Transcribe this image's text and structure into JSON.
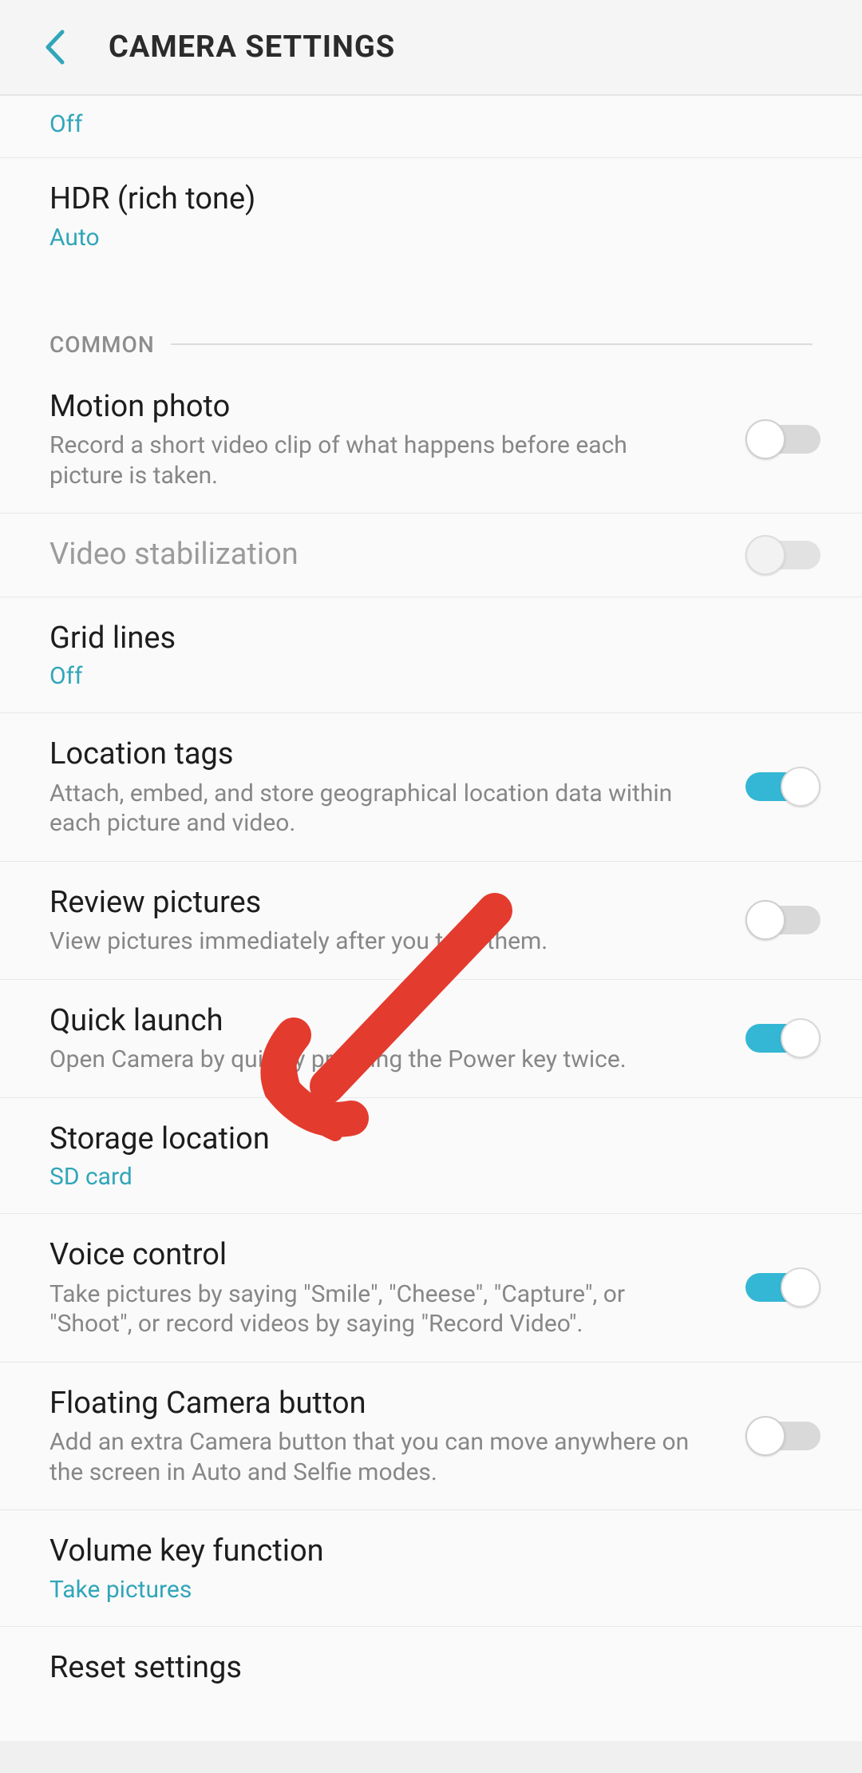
{
  "header": {
    "title": "CAMERA SETTINGS"
  },
  "partial": {
    "value": "Off"
  },
  "hdr": {
    "title": "HDR (rich tone)",
    "value": "Auto"
  },
  "sections": {
    "common_label": "COMMON"
  },
  "items": {
    "motion_photo": {
      "title": "Motion photo",
      "desc": "Record a short video clip of what happens before each picture is taken.",
      "on": false
    },
    "video_stabilization": {
      "title": "Video stabilization",
      "on": false,
      "disabled": true
    },
    "grid_lines": {
      "title": "Grid lines",
      "value": "Off"
    },
    "location_tags": {
      "title": "Location tags",
      "desc": "Attach, embed, and store geographical location data within each picture and video.",
      "on": true
    },
    "review_pictures": {
      "title": "Review pictures",
      "desc": "View pictures immediately after you take them.",
      "on": false
    },
    "quick_launch": {
      "title": "Quick launch",
      "desc": "Open Camera by quickly pressing the Power key twice.",
      "on": true
    },
    "storage_location": {
      "title": "Storage location",
      "value": "SD card"
    },
    "voice_control": {
      "title": "Voice control",
      "desc": "Take pictures by saying \"Smile\", \"Cheese\", \"Capture\", or \"Shoot\", or record videos by saying \"Record Video\".",
      "on": true
    },
    "floating_camera_button": {
      "title": "Floating Camera button",
      "desc": "Add an extra Camera button that you can move anywhere on the screen in Auto and Selfie modes.",
      "on": false
    },
    "volume_key_function": {
      "title": "Volume key function",
      "value": "Take pictures"
    },
    "reset_settings": {
      "title": "Reset settings"
    }
  },
  "colors": {
    "accent": "#31a6b9",
    "switch_on": "#34b7d4",
    "annotation": "#e33b2e"
  }
}
